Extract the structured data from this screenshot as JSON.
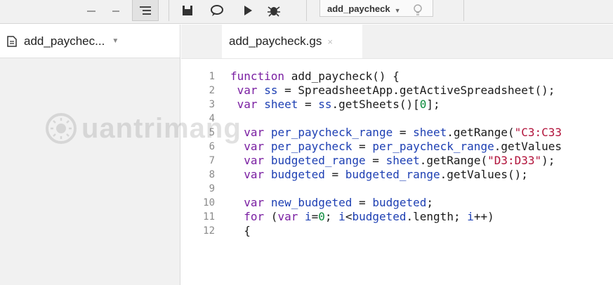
{
  "toolbar": {
    "function_select": "add_paycheck",
    "icons": [
      "format-icon",
      "save-icon",
      "comment-icon",
      "run-icon",
      "debug-icon",
      "function-select-caret-icon",
      "lightbulb-icon"
    ]
  },
  "sidebar": {
    "file_name": "add_paychec...",
    "file_icon": "document-icon"
  },
  "editor": {
    "tab_label": "add_paycheck.gs",
    "tab_close": "×",
    "lines": [
      {
        "num": "1",
        "tokens": [
          {
            "t": "kw",
            "v": "function"
          },
          {
            "t": "pl",
            "v": " add_paycheck() {"
          }
        ]
      },
      {
        "num": "2",
        "tokens": [
          {
            "t": "pl",
            "v": " "
          },
          {
            "t": "kw",
            "v": "var"
          },
          {
            "t": "pl",
            "v": " "
          },
          {
            "t": "vn",
            "v": "ss"
          },
          {
            "t": "pl",
            "v": " = SpreadsheetApp.getActiveSpreadsheet();"
          }
        ]
      },
      {
        "num": "3",
        "tokens": [
          {
            "t": "pl",
            "v": " "
          },
          {
            "t": "kw",
            "v": "var"
          },
          {
            "t": "pl",
            "v": " "
          },
          {
            "t": "vn",
            "v": "sheet"
          },
          {
            "t": "pl",
            "v": " = "
          },
          {
            "t": "vn",
            "v": "ss"
          },
          {
            "t": "pl",
            "v": ".getSheets()["
          },
          {
            "t": "nm",
            "v": "0"
          },
          {
            "t": "pl",
            "v": "];"
          }
        ]
      },
      {
        "num": "4",
        "tokens": []
      },
      {
        "num": "5",
        "tokens": [
          {
            "t": "pl",
            "v": "  "
          },
          {
            "t": "kw",
            "v": "var"
          },
          {
            "t": "pl",
            "v": " "
          },
          {
            "t": "vn",
            "v": "per_paycheck_range"
          },
          {
            "t": "pl",
            "v": " = "
          },
          {
            "t": "vn",
            "v": "sheet"
          },
          {
            "t": "pl",
            "v": ".getRange("
          },
          {
            "t": "st",
            "v": "\"C3:C33"
          }
        ]
      },
      {
        "num": "6",
        "tokens": [
          {
            "t": "pl",
            "v": "  "
          },
          {
            "t": "kw",
            "v": "var"
          },
          {
            "t": "pl",
            "v": " "
          },
          {
            "t": "vn",
            "v": "per_paycheck"
          },
          {
            "t": "pl",
            "v": " = "
          },
          {
            "t": "vn",
            "v": "per_paycheck_range"
          },
          {
            "t": "pl",
            "v": ".getValues"
          }
        ]
      },
      {
        "num": "7",
        "tokens": [
          {
            "t": "pl",
            "v": "  "
          },
          {
            "t": "kw",
            "v": "var"
          },
          {
            "t": "pl",
            "v": " "
          },
          {
            "t": "vn",
            "v": "budgeted_range"
          },
          {
            "t": "pl",
            "v": " = "
          },
          {
            "t": "vn",
            "v": "sheet"
          },
          {
            "t": "pl",
            "v": ".getRange("
          },
          {
            "t": "st",
            "v": "\"D3:D33\""
          },
          {
            "t": "pl",
            "v": ");"
          }
        ]
      },
      {
        "num": "8",
        "tokens": [
          {
            "t": "pl",
            "v": "  "
          },
          {
            "t": "kw",
            "v": "var"
          },
          {
            "t": "pl",
            "v": " "
          },
          {
            "t": "vn",
            "v": "budgeted"
          },
          {
            "t": "pl",
            "v": " = "
          },
          {
            "t": "vn",
            "v": "budgeted_range"
          },
          {
            "t": "pl",
            "v": ".getValues();"
          }
        ]
      },
      {
        "num": "9",
        "tokens": []
      },
      {
        "num": "10",
        "tokens": [
          {
            "t": "pl",
            "v": "  "
          },
          {
            "t": "kw",
            "v": "var"
          },
          {
            "t": "pl",
            "v": " "
          },
          {
            "t": "vn",
            "v": "new_budgeted"
          },
          {
            "t": "pl",
            "v": " = "
          },
          {
            "t": "vn",
            "v": "budgeted"
          },
          {
            "t": "pl",
            "v": ";"
          }
        ]
      },
      {
        "num": "11",
        "tokens": [
          {
            "t": "pl",
            "v": "  "
          },
          {
            "t": "kw",
            "v": "for"
          },
          {
            "t": "pl",
            "v": " ("
          },
          {
            "t": "kw",
            "v": "var"
          },
          {
            "t": "pl",
            "v": " "
          },
          {
            "t": "vn",
            "v": "i"
          },
          {
            "t": "pl",
            "v": "="
          },
          {
            "t": "nm",
            "v": "0"
          },
          {
            "t": "pl",
            "v": "; "
          },
          {
            "t": "vn",
            "v": "i"
          },
          {
            "t": "pl",
            "v": "<"
          },
          {
            "t": "vn",
            "v": "budgeted"
          },
          {
            "t": "pl",
            "v": ".length; "
          },
          {
            "t": "vn",
            "v": "i"
          },
          {
            "t": "pl",
            "v": "++)"
          }
        ]
      },
      {
        "num": "12",
        "tokens": [
          {
            "t": "pl",
            "v": "  {"
          }
        ]
      }
    ]
  },
  "watermark": {
    "text": "uantrimang"
  },
  "colors": {
    "keyword": "#7a1fa2",
    "variable": "#1d3fb3",
    "number": "#0a8a3a",
    "string": "#b1123a"
  }
}
